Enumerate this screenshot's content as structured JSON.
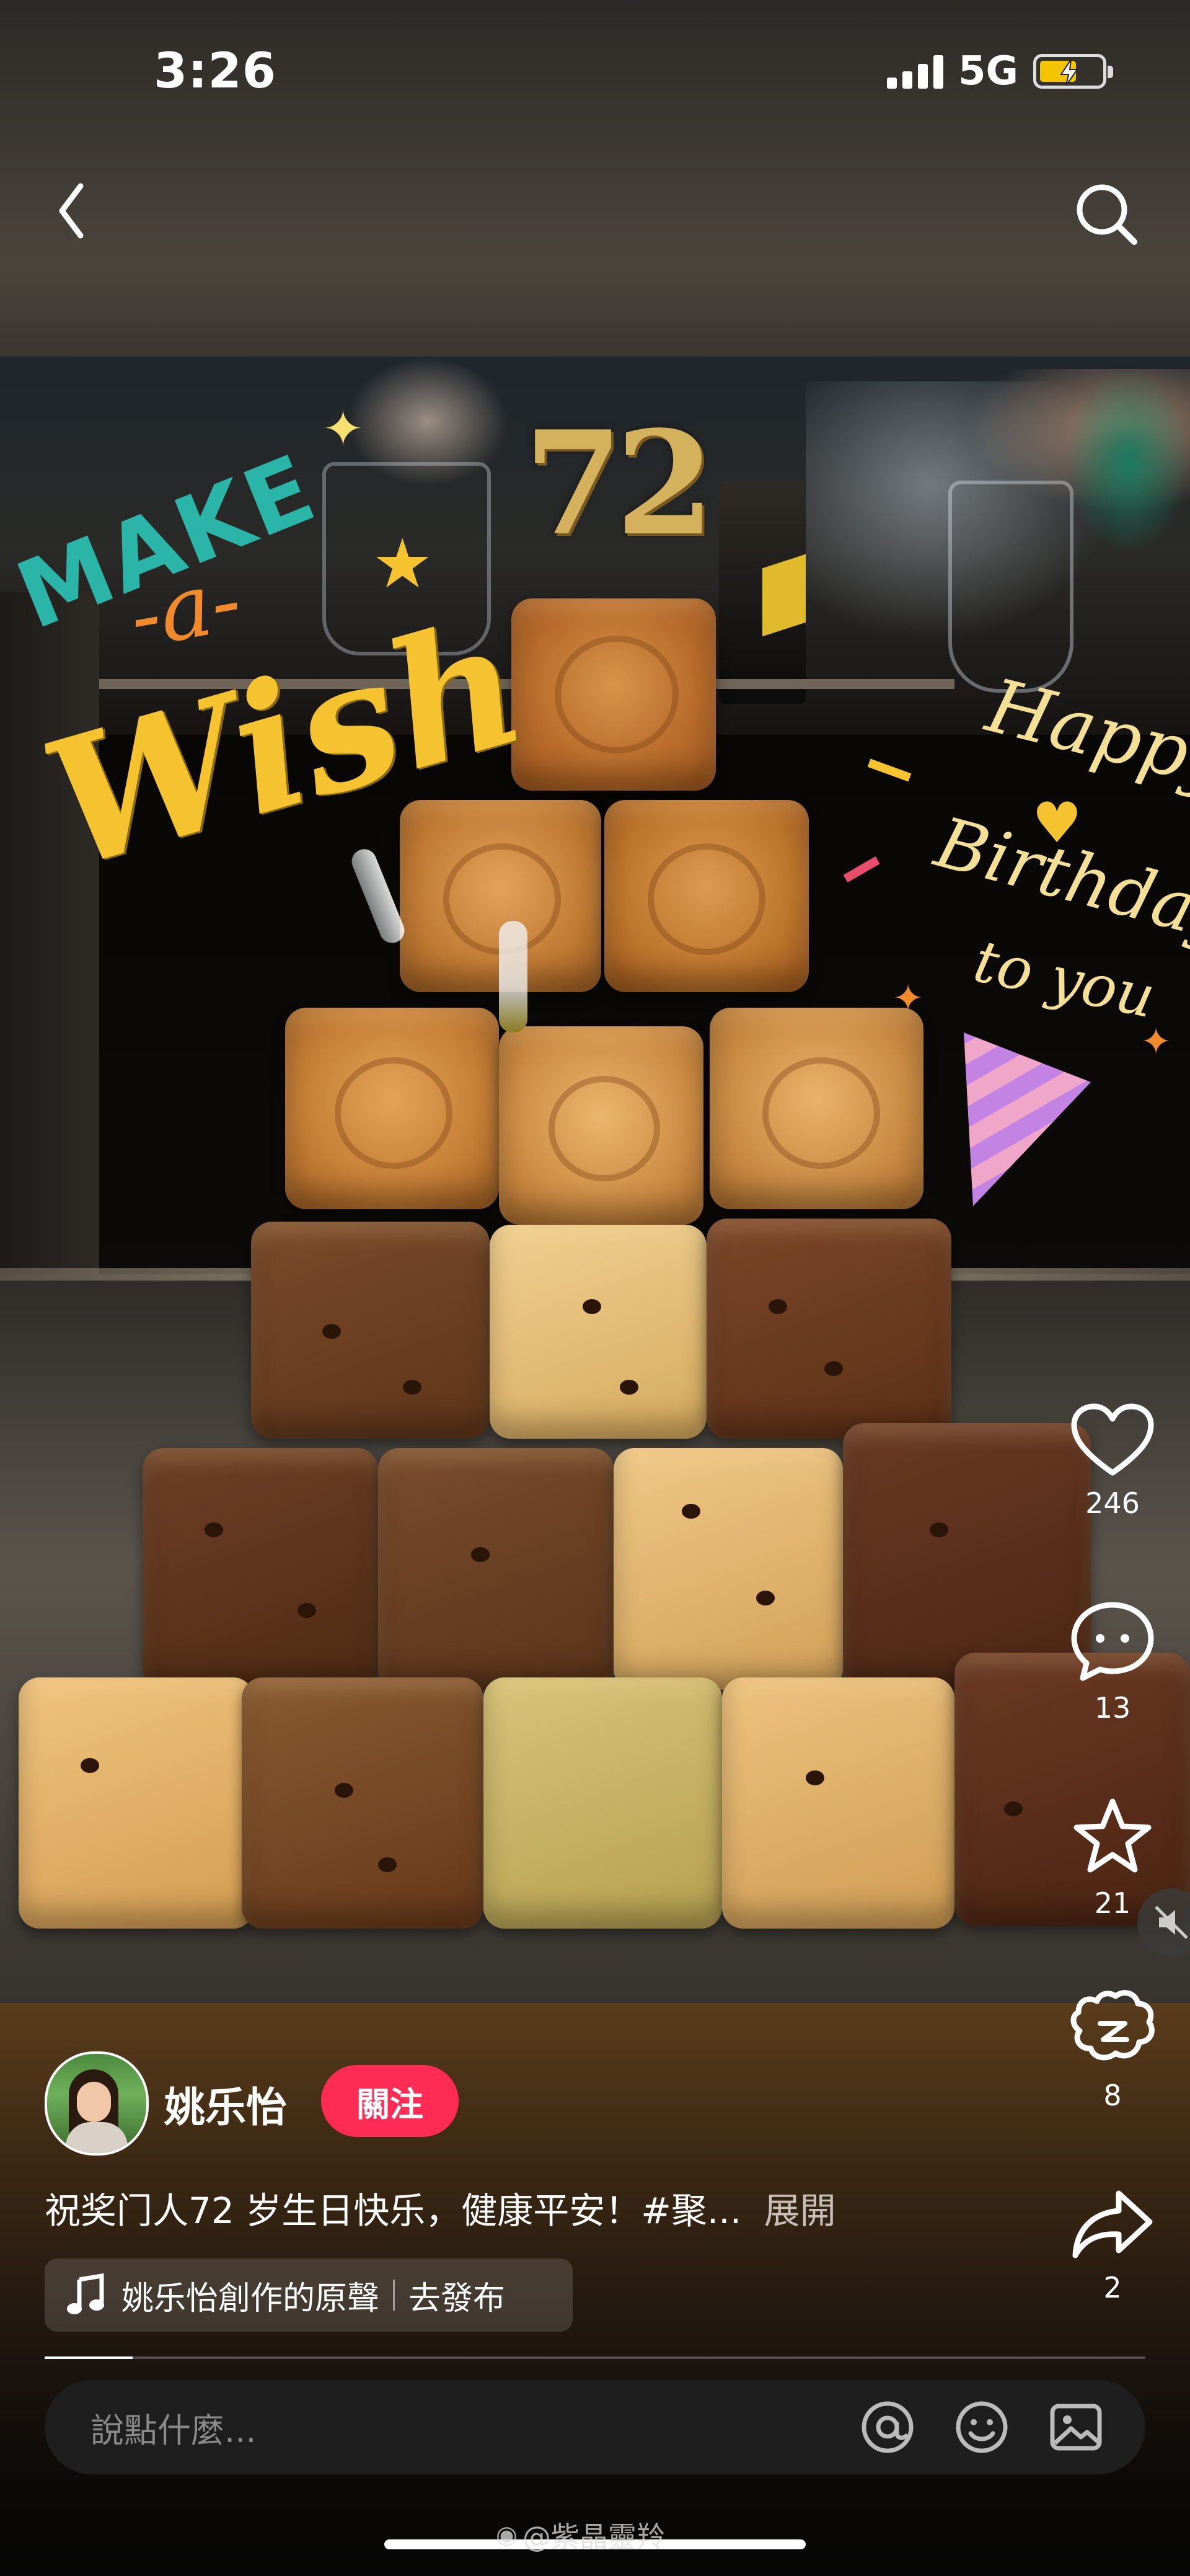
{
  "status_bar": {
    "time": "3:26",
    "network": "5G"
  },
  "overlay_text": {
    "make": "MAKE",
    "a": "-a-",
    "wish": "Wish",
    "candle": "72",
    "happy": "Happy",
    "birthday": "Birthday",
    "to_you": "to you"
  },
  "actions": {
    "likes": "246",
    "comments": "13",
    "favorites": "21",
    "reposts": "8",
    "shares": "2"
  },
  "author": {
    "name": "姚乐怡",
    "follow_label": "關注"
  },
  "caption": {
    "text": "祝奖门人72 岁生日快乐，健康平安！#聚...",
    "expand_label": "展開"
  },
  "music": {
    "title": "姚乐怡創作的原聲",
    "publish_label": "去發布"
  },
  "comment_input": {
    "placeholder": "說點什麼..."
  },
  "watermark": "@紫晶靈羚",
  "colors": {
    "follow": "#fe2c55",
    "wish_yellow": "#f5c230",
    "make_teal": "#2ab5a8",
    "orange": "#f08a2c"
  }
}
